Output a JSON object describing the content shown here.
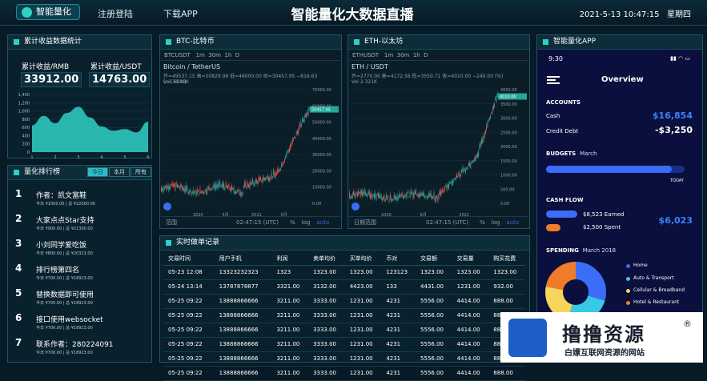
{
  "header": {
    "brand": "智能量化",
    "nav": [
      "注册登陆",
      "下载APP"
    ],
    "title": "智能量化大数据直播",
    "datetime": "2021-5-13 10:47:15",
    "weekday": "星期四"
  },
  "earnings": {
    "title": "累计收益数据统计",
    "rmb_label": "累计收益/RMB",
    "rmb_value": "33912.00",
    "usdt_label": "累计收益/USDT",
    "usdt_value": "14763.00",
    "y_ticks": [
      "1,400",
      "1,200",
      "1,000",
      "800",
      "600",
      "400",
      "200",
      "0"
    ],
    "x_ticks": [
      "1",
      "2",
      "3",
      "4",
      "5",
      "6"
    ],
    "chart_data": {
      "type": "area",
      "x": [
        1,
        1.5,
        2,
        2.5,
        3,
        3.5,
        4,
        4.5,
        5,
        5.5,
        6
      ],
      "y": [
        650,
        880,
        700,
        950,
        1100,
        840,
        620,
        520,
        560,
        480,
        740
      ],
      "ylim": [
        0,
        1400
      ],
      "color": "#2fd0c7"
    }
  },
  "btc": {
    "title": "BTC-比特币",
    "symbol": "BTCUSDT",
    "intervals": [
      "1m",
      "30m",
      "1h",
      "D"
    ],
    "pair_label": "Bitcoin / TetherUS",
    "ohlc": "开=49537.15 高=50829.98 低=46000.00 收=30457.95 −816.63 (−1.63%)",
    "vol": "Vol 34.89K",
    "price_tag": "50457.95",
    "y_ticks": [
      "70000.00",
      "60000.00",
      "50000.00",
      "40000.00",
      "30000.00",
      "20000.00",
      "10000.00",
      "0.00"
    ],
    "x_ticks": [
      "2020",
      "5月",
      "2021",
      "5月"
    ],
    "range_label": "范围",
    "time_label": "02:47:15 (UTC)",
    "pct": "%",
    "log": "log",
    "auto": "auto"
  },
  "eth": {
    "title": "ETH-以太坊",
    "symbol": "ETHUSDT",
    "intervals": [
      "1m",
      "30m",
      "1h",
      "D"
    ],
    "pair_label": "ETH / USDT",
    "ohlc": "开=2770.00 高=4172.56 低=3550.71 收=4010.00 −240.00 (%)",
    "vol": "Vol 2.321K",
    "price_tag": "4010.00",
    "y_ticks": [
      "4000.00",
      "3500.00",
      "3000.00",
      "2500.00",
      "2000.00",
      "1500.00",
      "1000.00",
      "500.00",
      "0.00"
    ],
    "x_ticks": [
      "2020",
      "6月",
      "2021"
    ],
    "range_label": "日期范围",
    "time_label": "02:47:15 (UTC)",
    "pct": "%",
    "log": "log",
    "auto": "auto"
  },
  "ranking": {
    "title": "量化排行榜",
    "tabs": [
      "今日",
      "本月",
      "所有"
    ],
    "items": [
      {
        "num": "1",
        "name": "作者：凯文富鞋",
        "sub": "今日 ¥1000.00 | 总 ¥22000.00"
      },
      {
        "num": "2",
        "name": "大家点点Star支持",
        "sub": "今日 ¥900.00 | 总 ¥21300.00"
      },
      {
        "num": "3",
        "name": "小刘同学爱吃饭",
        "sub": "今日 ¥800.00 | 总 ¥20323.00"
      },
      {
        "num": "4",
        "name": "排行榜第四名",
        "sub": "今日 ¥700.00 | 总 ¥18923.00"
      },
      {
        "num": "5",
        "name": "替换数据即可使用",
        "sub": "今日 ¥700.00 | 总 ¥18923.00"
      },
      {
        "num": "6",
        "name": "接口使用websocket",
        "sub": "今日 ¥700.00 | 总 ¥18923.00"
      },
      {
        "num": "7",
        "name": "联系作者：280224091",
        "sub": "今日 ¥700.00 | 总 ¥18923.00"
      }
    ]
  },
  "trades": {
    "title": "实时做单记录",
    "headers": [
      "交易时间",
      "用户手机",
      "利润",
      "卖单均价",
      "买单均价",
      "币对",
      "交易额",
      "交易量",
      "购买花费"
    ],
    "rows": [
      [
        "05-23 12:08",
        "13323232323",
        "1323",
        "1323.00",
        "1323.00",
        "123123",
        "1323.00",
        "1323.00",
        "1323.00"
      ],
      [
        "05-24 13:14",
        "13787878877",
        "3321.00",
        "3132.00",
        "4423.00",
        "133",
        "4431.00",
        "1231.00",
        "932.00"
      ],
      [
        "05-25 09:22",
        "13888866666",
        "3211.00",
        "3333.00",
        "1231.00",
        "4231",
        "5556.00",
        "4414.00",
        "888.00"
      ],
      [
        "05-25 09:22",
        "13888866666",
        "3211.00",
        "3333.00",
        "1231.00",
        "4231",
        "5556.00",
        "4414.00",
        "888.00"
      ],
      [
        "05-25 09:22",
        "13888866666",
        "3211.00",
        "3333.00",
        "1231.00",
        "4231",
        "5556.00",
        "4414.00",
        "888.00"
      ],
      [
        "05-25 09:22",
        "13888866666",
        "3211.00",
        "3333.00",
        "1231.00",
        "4231",
        "5556.00",
        "4414.00",
        "888.00"
      ],
      [
        "05-25 09:22",
        "13888866666",
        "3211.00",
        "3333.00",
        "1231.00",
        "4231",
        "5556.00",
        "4414.00",
        "888.00"
      ],
      [
        "05-25 09:22",
        "13888866666",
        "3211.00",
        "3333.00",
        "1231.00",
        "4231",
        "5556.00",
        "4414.00",
        "888.00"
      ]
    ]
  },
  "app": {
    "title": "智能量化APP",
    "time": "9:30",
    "overview": "Overview",
    "accounts_title": "ACCOUNTS",
    "cash_label": "Cash",
    "cash_value": "$16,854",
    "credit_label": "Credit Debt",
    "credit_value": "-$3,250",
    "budgets_title": "BUDGETS",
    "budgets_month": "March",
    "budget_fill": 0.91,
    "today_label": "TODAY",
    "cashflow_title": "CASH FLOW",
    "earned_label": "$8,523 Earned",
    "spent_label": "$2,500 Spent",
    "cashflow_value": "$6,023",
    "spending_title": "SPENDING",
    "spending_month": "March 2018",
    "spending_legend": [
      {
        "label": "Home",
        "color": "#3b6df7"
      },
      {
        "label": "Auto & Transport",
        "color": "#37c9e5"
      },
      {
        "label": "Cellular & Broadband",
        "color": "#f7d45a"
      },
      {
        "label": "Hotel & Restaurant",
        "color": "#f07c2a"
      }
    ],
    "accent_blue": "#3b6df7",
    "accent_orange": "#f07c2a"
  },
  "ad": {
    "main": "撸撸资源",
    "reg": "®",
    "sub": "白嫖互联网资源的网站"
  }
}
